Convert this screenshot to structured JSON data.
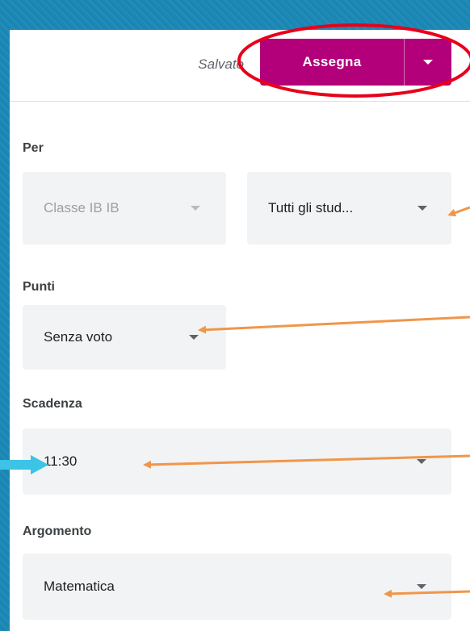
{
  "header": {
    "saved_text": "Salvato",
    "assign_label": "Assegna",
    "assign_menu_icon": "caret-down-icon",
    "accent_color": "#b3007a"
  },
  "for_section": {
    "label": "Per",
    "class_value": "Classe IB IB",
    "students_value": "Tutti gli stud..."
  },
  "points_section": {
    "label": "Punti",
    "value": "Senza voto"
  },
  "due_section": {
    "label": "Scadenza",
    "value": "11:30"
  },
  "topic_section": {
    "label": "Argomento",
    "value": "Matematica"
  },
  "annotations": {
    "highlight_color": "#e8001a",
    "arrow_color": "#f0964a",
    "pointer_color": "#3cc3e6"
  }
}
